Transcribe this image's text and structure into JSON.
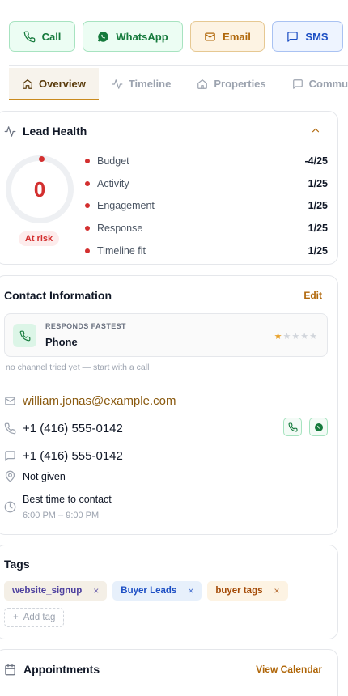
{
  "actions": {
    "call": "Call",
    "whatsapp": "WhatsApp",
    "email": "Email",
    "sms": "SMS"
  },
  "tabs": [
    {
      "label": "Overview",
      "active": true
    },
    {
      "label": "Timeline",
      "active": false
    },
    {
      "label": "Properties",
      "active": false
    },
    {
      "label": "Commu",
      "active": false
    }
  ],
  "lead_health": {
    "title": "Lead Health",
    "score": "0",
    "status": "At risk",
    "metrics": [
      {
        "name": "Budget",
        "score": "-4/25"
      },
      {
        "name": "Activity",
        "score": "1/25"
      },
      {
        "name": "Engagement",
        "score": "1/25"
      },
      {
        "name": "Response",
        "score": "1/25"
      },
      {
        "name": "Timeline fit",
        "score": "1/25"
      }
    ]
  },
  "contact": {
    "title": "Contact Information",
    "edit": "Edit",
    "fastest_label": "RESPONDS FASTEST",
    "fastest_channel": "Phone",
    "rating": 1,
    "hint": "no channel tried yet — start with a call",
    "email": "william.jonas@example.com",
    "phone": "+1 (416) 555-0142",
    "sms": "+1 (416) 555-0142",
    "address": "Not given",
    "best_time_label": "Best time to contact",
    "best_time_value": "6:00 PM – 9:00 PM"
  },
  "tags": {
    "title": "Tags",
    "items": [
      "website_signup",
      "Buyer Leads",
      "buyer tags"
    ],
    "add": "Add tag"
  },
  "appointments": {
    "title": "Appointments",
    "link": "View Calendar"
  },
  "colors": {
    "accent": "#c98a1e",
    "risk": "#d32f2f",
    "green": "#157a3c"
  }
}
